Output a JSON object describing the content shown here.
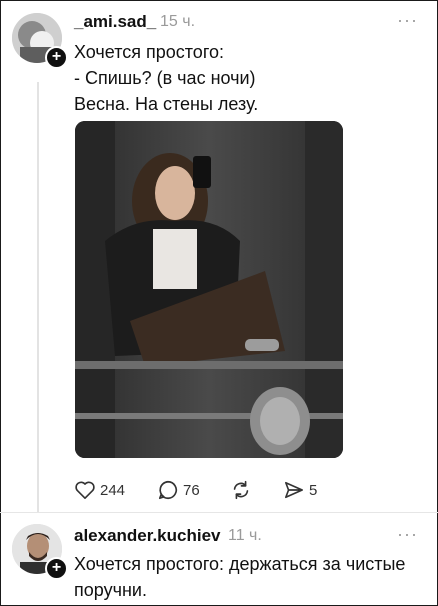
{
  "post1": {
    "username": "_ami.sad_",
    "time": "15 ч.",
    "more": "···",
    "lines": [
      "Хочется простого:",
      "- Спишь? (в час ночи)",
      "Весна. На стены лезу."
    ],
    "actions": {
      "likes": "244",
      "comments": "76",
      "repost": "",
      "shares": "5"
    }
  },
  "post2": {
    "username": "alexander.kuchiev",
    "time": "11 ч.",
    "more": "···",
    "lines": [
      "Хочется простого: держаться за чистые",
      "поручни."
    ]
  },
  "icons": {
    "plus": "+",
    "like": "heart-icon",
    "comment": "comment-icon",
    "repost": "repost-icon",
    "share": "share-icon"
  }
}
